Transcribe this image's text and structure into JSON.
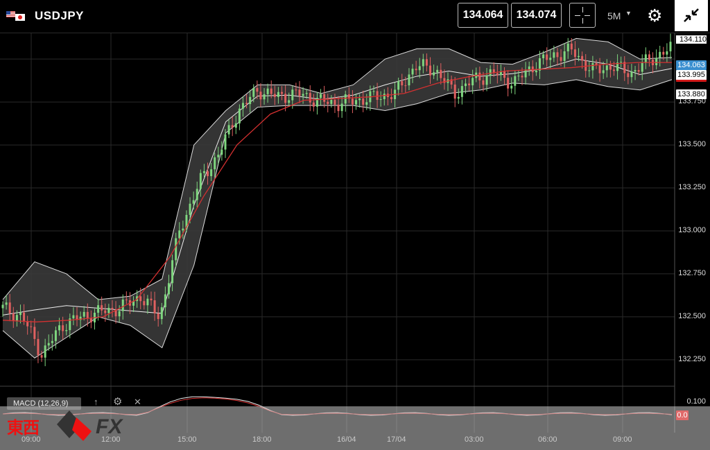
{
  "header": {
    "symbol": "USDJPY",
    "bid": "134.064",
    "ask": "134.074",
    "timeframe": "5M"
  },
  "price_axis": {
    "labels": [
      "134.110",
      "133.750",
      "133.500",
      "133.250",
      "133.000",
      "132.750",
      "132.500",
      "132.250"
    ],
    "current_tag": "134.063",
    "upper_band_tag": "133.995",
    "lower_band_tag": "133.880",
    "macd_axis_label": "0.100",
    "macd_zero_tag": "0.0"
  },
  "indicator": {
    "macd_label": "MACD (12,26,9)"
  },
  "time_axis": {
    "labels": [
      "09:00",
      "12:00",
      "15:00",
      "18:00",
      "16/04",
      "17/04",
      "03:00",
      "06:00",
      "09:00"
    ]
  },
  "logo": {
    "kanji": "東西",
    "fx": "FX"
  },
  "colors": {
    "bg": "#000000",
    "band_fill": "#3a3a3a",
    "up_candle": "#7fd67f",
    "down_candle": "#e06060",
    "ma_red": "#d33030",
    "current_price": "#3a8fd0",
    "upper_tag": "#d11a1a"
  },
  "chart_data": {
    "type": "candlestick",
    "title": "",
    "ylim": [
      132.1,
      134.15
    ],
    "x_ticks": [
      "09:00",
      "12:00",
      "15:00",
      "18:00",
      "16/04",
      "17/04",
      "03:00",
      "06:00",
      "09:00"
    ],
    "approx_mid": [
      132.55,
      132.5,
      132.28,
      132.45,
      132.5,
      132.53,
      132.55,
      132.62,
      132.5,
      133.0,
      133.28,
      133.45,
      133.7,
      133.82,
      133.78,
      133.8,
      133.76,
      133.74,
      133.76,
      133.78,
      133.8,
      133.96,
      133.94,
      133.8,
      133.88,
      133.92,
      133.86,
      133.96,
      134.02,
      134.05,
      133.93,
      133.96,
      133.92,
      134.0,
      134.06
    ],
    "bollinger_upper": [
      132.6,
      132.82,
      132.75,
      132.6,
      132.62,
      132.72,
      133.5,
      133.7,
      133.85,
      133.85,
      133.8,
      133.85,
      134.0,
      134.06,
      134.06,
      133.98,
      133.97,
      134.04,
      134.12,
      134.1,
      134.0,
      134.01
    ],
    "bollinger_lower": [
      132.42,
      132.26,
      132.38,
      132.5,
      132.45,
      132.32,
      132.8,
      133.57,
      133.72,
      133.73,
      133.73,
      133.73,
      133.7,
      133.74,
      133.8,
      133.82,
      133.86,
      133.85,
      133.88,
      133.84,
      133.82,
      133.88
    ],
    "moving_average": [
      132.48,
      132.47,
      132.48,
      132.5,
      132.6,
      132.85,
      133.2,
      133.5,
      133.68,
      133.76,
      133.77,
      133.78,
      133.8,
      133.86,
      133.9,
      133.93,
      133.94,
      133.95,
      133.97,
      133.98,
      133.98
    ]
  }
}
